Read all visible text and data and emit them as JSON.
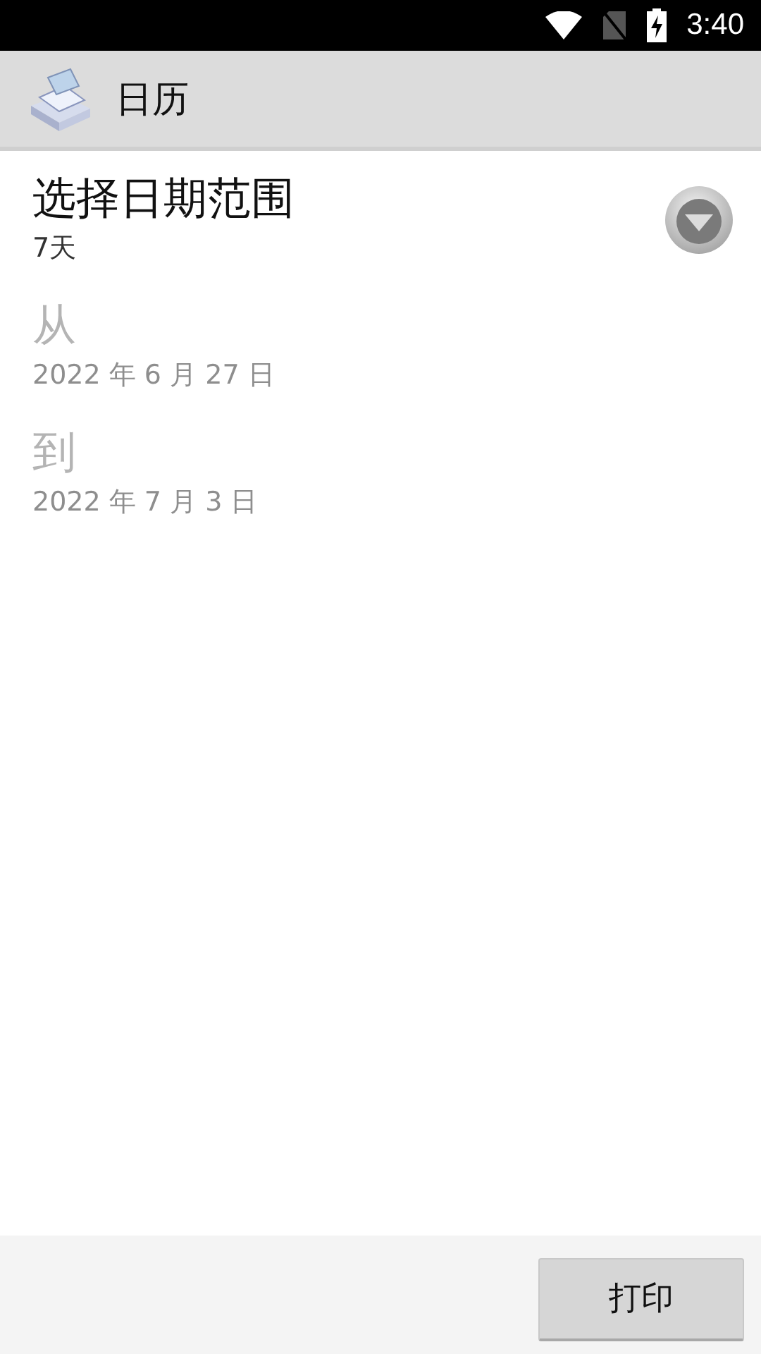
{
  "status_bar": {
    "time": "3:40"
  },
  "app_bar": {
    "title": "日历"
  },
  "settings": [
    {
      "title": "选择日期范围",
      "value": "7天",
      "disabled": false,
      "kind": "dropdown"
    },
    {
      "title": "从",
      "value": "2022 年 6 月 27 日",
      "disabled": true,
      "kind": "plain"
    },
    {
      "title": "到",
      "value": "2022 年 7 月 3 日",
      "disabled": true,
      "kind": "plain"
    }
  ],
  "buttons": [
    "打印"
  ]
}
